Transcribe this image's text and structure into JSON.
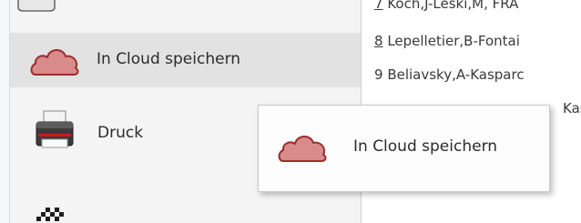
{
  "menu": {
    "items": [
      {
        "label": "In Cloud speichern",
        "icon": "cloud-icon",
        "state": "hovered"
      },
      {
        "label": "Druck",
        "icon": "printer-icon"
      }
    ]
  },
  "list": {
    "rows": [
      {
        "num": "7",
        "text": " Koch,J-Leski,M, FRA"
      },
      {
        "num": "8",
        "text": " Lepelletier,B-Fontai"
      },
      {
        "num": "9",
        "text": " Beliavsky,A-Kasparc"
      },
      {
        "num": "",
        "text": "Kasp"
      }
    ]
  },
  "tooltip": {
    "label": "In Cloud speichern",
    "icon": "cloud-icon"
  },
  "colors": {
    "cloud_fill": "#d98a8a",
    "cloud_stroke": "#9b2d2d",
    "hover_bg": "#e2e2e2",
    "menu_bg": "#f4f4f4"
  }
}
